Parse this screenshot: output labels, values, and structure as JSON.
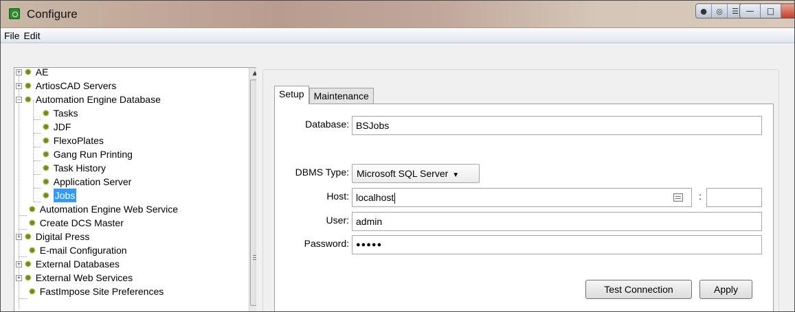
{
  "window": {
    "title": "Configure"
  },
  "title_buttons": {
    "extras": [
      "●",
      "◎",
      "☰",
      "▭",
      "●"
    ],
    "minimize": "—",
    "maximize": "□",
    "close": "X"
  },
  "menu": {
    "items": [
      "File",
      "Edit"
    ]
  },
  "tree": {
    "items": [
      {
        "label": "AE",
        "expandable": true
      },
      {
        "label": "ArtiosCAD Servers",
        "expandable": true
      },
      {
        "label": "Automation Engine Database",
        "expanded": true
      },
      {
        "label": "Tasks"
      },
      {
        "label": "JDF"
      },
      {
        "label": "FlexoPlates"
      },
      {
        "label": "Gang Run Printing"
      },
      {
        "label": "Task History"
      },
      {
        "label": "Application Server"
      },
      {
        "label": "Jobs",
        "selected": true
      },
      {
        "label": "Automation Engine Web Service"
      },
      {
        "label": "Create DCS Master"
      },
      {
        "label": "Digital Press",
        "expandable": true
      },
      {
        "label": "E-mail Configuration"
      },
      {
        "label": "External Databases",
        "expandable": true
      },
      {
        "label": "External Web Services",
        "expandable": true
      },
      {
        "label": "FastImpose Site Preferences"
      }
    ]
  },
  "tabs": {
    "setup": "Setup",
    "maintenance": "Maintenance",
    "active": "Setup"
  },
  "form": {
    "database_label": "Database:",
    "database_value": "BSJobs",
    "dbms_label": "DBMS Type:",
    "dbms_value": "Microsoft SQL Server",
    "host_label": "Host:",
    "host_value": "localhost",
    "port_separator": ":",
    "port_value": "",
    "user_label": "User:",
    "user_value": "admin",
    "password_label": "Password:",
    "password_value": "●●●●●"
  },
  "buttons": {
    "test_connection": "Test Connection",
    "apply": "Apply"
  }
}
